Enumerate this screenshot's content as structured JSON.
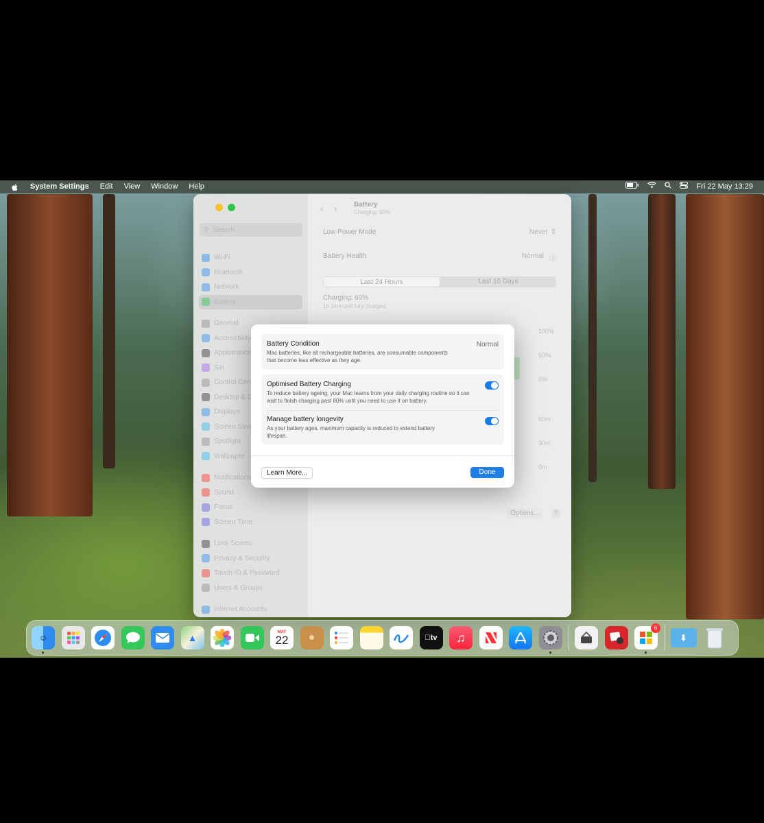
{
  "menubar": {
    "app_name": "System Settings",
    "menus": [
      "Edit",
      "View",
      "Window",
      "Help"
    ],
    "datetime": "Fri 22 May  13:29"
  },
  "sidebar": {
    "search_placeholder": "Search",
    "groups": [
      [
        "Wi-Fi",
        "Bluetooth",
        "Network",
        "Battery"
      ],
      [
        "General",
        "Accessibility",
        "Appearance",
        "Siri",
        "Control Centre",
        "Desktop & Dock",
        "Displays",
        "Screen Saver",
        "Spotlight",
        "Wallpaper"
      ],
      [
        "Notifications",
        "Sound",
        "Focus",
        "Screen Time"
      ],
      [
        "Lock Screen",
        "Privacy & Security",
        "Touch ID & Password",
        "Users & Groups"
      ],
      [
        "Internet Accounts"
      ]
    ],
    "selected": "Battery"
  },
  "content": {
    "title": "Battery",
    "subtitle": "Charging: 60%",
    "low_power_label": "Low Power Mode",
    "low_power_value": "Never",
    "health_label": "Battery Health",
    "health_value": "Normal",
    "tab_24h": "Last 24 Hours",
    "tab_10d": "Last 10 Days",
    "charging_label": "Charging: 60%",
    "charging_sub": "1h 34m until fully charged",
    "axis_pct": [
      "100%",
      "50%",
      "0%"
    ],
    "axis_time": [
      "60m",
      "30m",
      "0m"
    ],
    "options_label": "Options...",
    "help_label": "?"
  },
  "dialog": {
    "condition_title": "Battery Condition",
    "condition_value": "Normal",
    "condition_desc": "Mac batteries, like all rechargeable batteries, are consumable components that become less effective as they age.",
    "optimised_title": "Optimised Battery Charging",
    "optimised_desc": "To reduce battery ageing, your Mac learns from your daily charging routine so it can wait to finish charging past 80% until you need to use it on battery.",
    "optimised_on": true,
    "longevity_title": "Manage battery longevity",
    "longevity_desc": "As your battery ages, maximum capacity is reduced to extend battery lifespan.",
    "longevity_on": true,
    "learn_more_label": "Learn More...",
    "done_label": "Done"
  },
  "dock": {
    "calendar_month": "MAY",
    "calendar_day": "22",
    "tv_label": "tv",
    "badge_count": "6"
  },
  "colors": {
    "accent": "#1f7fe6",
    "toggle_on": "#1b7ce2"
  }
}
